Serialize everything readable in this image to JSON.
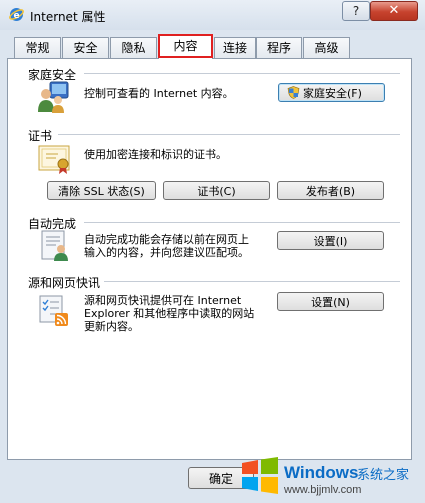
{
  "window": {
    "title": "Internet 属性",
    "help_label": "?",
    "close_label": "✕"
  },
  "tabs": [
    {
      "label": "常规"
    },
    {
      "label": "安全"
    },
    {
      "label": "隐私"
    },
    {
      "label": "内容",
      "active": true
    },
    {
      "label": "连接"
    },
    {
      "label": "程序"
    },
    {
      "label": "高级"
    }
  ],
  "family_safety": {
    "title": "家庭安全",
    "description": "控制可查看的 Internet 内容。",
    "button_label": "家庭安全(F)"
  },
  "certificates": {
    "title": "证书",
    "description": "使用加密连接和标识的证书。",
    "clear_ssl_label": "清除 SSL 状态(S)",
    "certificates_label": "证书(C)",
    "publishers_label": "发布者(B)"
  },
  "autocomplete": {
    "title": "自动完成",
    "description_line1": "自动完成功能会存储以前在网页上",
    "description_line2": "输入的内容，并向您建议匹配项。",
    "settings_label": "设置(I)"
  },
  "feeds": {
    "title": "源和网页快讯",
    "description_line1": "源和网页快讯提供可在 Internet",
    "description_line2": "Explorer 和其他程序中读取的网站",
    "description_line3": "更新内容。",
    "settings_label": "设置(N)"
  },
  "footer": {
    "ok_label": "确定"
  },
  "watermark": {
    "brand": "Windows",
    "suffix": "系统之家",
    "url": "www.bjjmlv.com"
  }
}
